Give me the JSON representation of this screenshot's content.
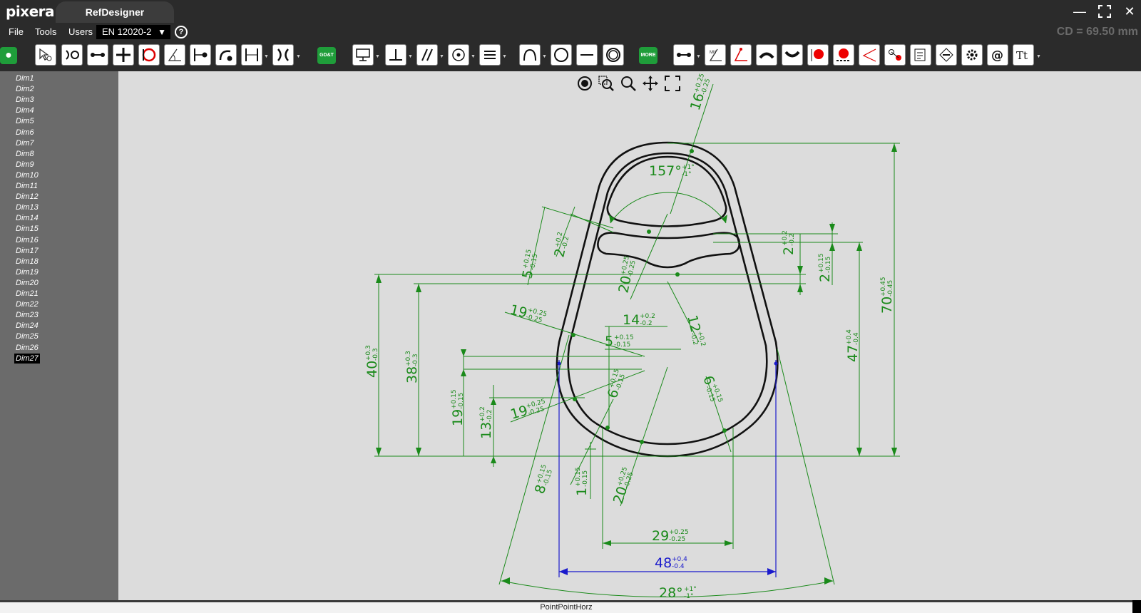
{
  "app": {
    "logo": "pixera",
    "tab_title": "RefDesigner",
    "window_controls": [
      "minimize",
      "maximize",
      "close"
    ]
  },
  "menu": {
    "items": [
      "File",
      "Tools",
      "Users"
    ],
    "standard_select": "EN 12020-2",
    "help_label": "?",
    "cd_readout": "CD = 69.50 mm"
  },
  "toolbar": {
    "groups": [
      [
        "add-icon"
      ],
      [
        "select-icon",
        "arc-gap-icon",
        "point-point-icon",
        "crosshair-line-icon",
        "circle-red-icon",
        "angle-icon",
        "point-line-icon",
        "arc-point-icon",
        "line-line-icon",
        "arc-arc-icon"
      ],
      [
        "gdt-icon"
      ],
      [
        "monitor-icon",
        "perpendicular-icon",
        "parallel-icon",
        "concentric-icon",
        "equal-lines-icon",
        "arc-icon",
        "circle-icon",
        "horizontal-line-icon",
        "double-circle-icon"
      ],
      [
        "more-icon"
      ],
      [
        "point-dim-icon",
        "angle-dim-icon",
        "red-angle-icon",
        "convex-curve-icon",
        "concave-curve-icon",
        "red-dot-icon",
        "red-dot-base-icon",
        "red-lines-icon",
        "red-points-icon",
        "notes-icon",
        "diamond-icon",
        "gear-icon",
        "at-icon",
        "text-icon"
      ]
    ],
    "gdt_label": "GD&T",
    "more_label": "MORE"
  },
  "sidebar": {
    "items": [
      "Dim1",
      "Dim2",
      "Dim3",
      "Dim4",
      "Dim5",
      "Dim6",
      "Dim7",
      "Dim8",
      "Dim9",
      "Dim10",
      "Dim11",
      "Dim12",
      "Dim13",
      "Dim14",
      "Dim15",
      "Dim16",
      "Dim17",
      "Dim18",
      "Dim19",
      "Dim20",
      "Dim21",
      "Dim22",
      "Dim23",
      "Dim24",
      "Dim25",
      "Dim26",
      "Dim27"
    ],
    "selected": "Dim27"
  },
  "view_tools": [
    "view-eye-icon",
    "zoom-window-icon",
    "zoom-icon",
    "pan-icon",
    "fit-icon"
  ],
  "drawing": {
    "colors": {
      "dimension": "#1a8a1a",
      "profile": "#111111",
      "highlight": "#1a1acc",
      "canvas": "#dcdcdc"
    },
    "dimensions": [
      {
        "value": "16",
        "tol_plus": "+0.25",
        "tol_minus": "-0.25"
      },
      {
        "value": "157°",
        "tol_plus": "+1°",
        "tol_minus": "-1°"
      },
      {
        "value": "2",
        "tol_plus": "+0.2",
        "tol_minus": "-0.2"
      },
      {
        "value": "5",
        "tol_plus": "+0.15",
        "tol_minus": "-0.15"
      },
      {
        "value": "20",
        "tol_plus": "+0.25",
        "tol_minus": "-0.25"
      },
      {
        "value": "2",
        "tol_plus": "+0.2",
        "tol_minus": "-0.2"
      },
      {
        "value": "2",
        "tol_plus": "+0.15",
        "tol_minus": "-0.15"
      },
      {
        "value": "70",
        "tol_plus": "+0.45",
        "tol_minus": "-0.45"
      },
      {
        "value": "19",
        "tol_plus": "+0.25",
        "tol_minus": "-0.25"
      },
      {
        "value": "14",
        "tol_plus": "+0.2",
        "tol_minus": "-0.2"
      },
      {
        "value": "12",
        "tol_plus": "+0.2",
        "tol_minus": "-0.2"
      },
      {
        "value": "5",
        "tol_plus": "+0.15",
        "tol_minus": "-0.15"
      },
      {
        "value": "40",
        "tol_plus": "+0.3",
        "tol_minus": "-0.3"
      },
      {
        "value": "38",
        "tol_plus": "+0.3",
        "tol_minus": "-0.3"
      },
      {
        "value": "47",
        "tol_plus": "+0.4",
        "tol_minus": "-0.4"
      },
      {
        "value": "6",
        "tol_plus": "+0.15",
        "tol_minus": "-0.15"
      },
      {
        "value": "6",
        "tol_plus": "+0.15",
        "tol_minus": "-0.15"
      },
      {
        "value": "19",
        "tol_plus": "+0.25",
        "tol_minus": "-0.25"
      },
      {
        "value": "19",
        "tol_plus": "+0.15",
        "tol_minus": "-0.15"
      },
      {
        "value": "13",
        "tol_plus": "+0.2",
        "tol_minus": "-0.2"
      },
      {
        "value": "8",
        "tol_plus": "+0.15",
        "tol_minus": "-0.15"
      },
      {
        "value": "1",
        "tol_plus": "+0.15",
        "tol_minus": "-0.15"
      },
      {
        "value": "20",
        "tol_plus": "+0.25",
        "tol_minus": "-0.25"
      },
      {
        "value": "29",
        "tol_plus": "+0.25",
        "tol_minus": "-0.25"
      },
      {
        "value": "48",
        "tol_plus": "+0.4",
        "tol_minus": "-0.4"
      },
      {
        "value": "28°",
        "tol_plus": "+1°",
        "tol_minus": "-1°"
      }
    ]
  },
  "status": {
    "text": "PointPointHorz"
  }
}
